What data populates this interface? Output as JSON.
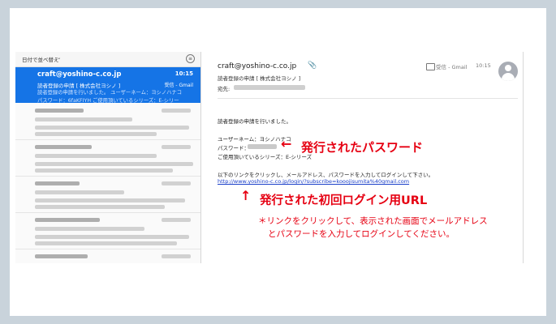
{
  "list": {
    "sort_label": "日付で並べ替え",
    "selected": {
      "from": "craft@yoshino-c.co.jp",
      "time": "10:15",
      "subject": "読者登録の申請 [ 株式会社ヨシノ ]",
      "mailbox": "受信 - Gmail",
      "preview_1": "読者登録の申請を行いました。 ユーザーネーム：ヨシノハナコ",
      "preview_2": "パスワード：6faKFIYH ご使用頂いているシリーズ：E-シリー"
    }
  },
  "detail": {
    "from": "craft@yoshino-c.co.jp",
    "subject": "読者登録の申請 [ 株式会社ヨシノ ]",
    "to_label": "宛先:",
    "mailbox": "受信 - Gmail",
    "time": "10:15",
    "body_line1": "読者登録の申請を行いました。",
    "username_line": "ユーザーネーム：ヨシノハナコ",
    "password_label": "パスワード：",
    "series_line": "ご使用頂いているシリーズ：E-シリーズ",
    "instruction": "以下のリンクをクリックし、メールアドレス、パスワードを入力してログインして下さい。",
    "link": "http://www.yoshino-c.co.jp/login/?subscribe=kooojisumita%40gmail.com"
  },
  "annotations": {
    "password_arrow": "←",
    "password_label": "発行されたパスワード",
    "url_arrow": "↑",
    "url_label": "発行された初回ログイン用URL",
    "note_1": "＊リンクをクリックして、表示された画面でメールアドレス",
    "note_2": "とパスワードを入力してログインしてください。"
  },
  "colors": {
    "selection": "#1574e6",
    "annotation": "#e60012",
    "link": "#1a3fc9"
  }
}
